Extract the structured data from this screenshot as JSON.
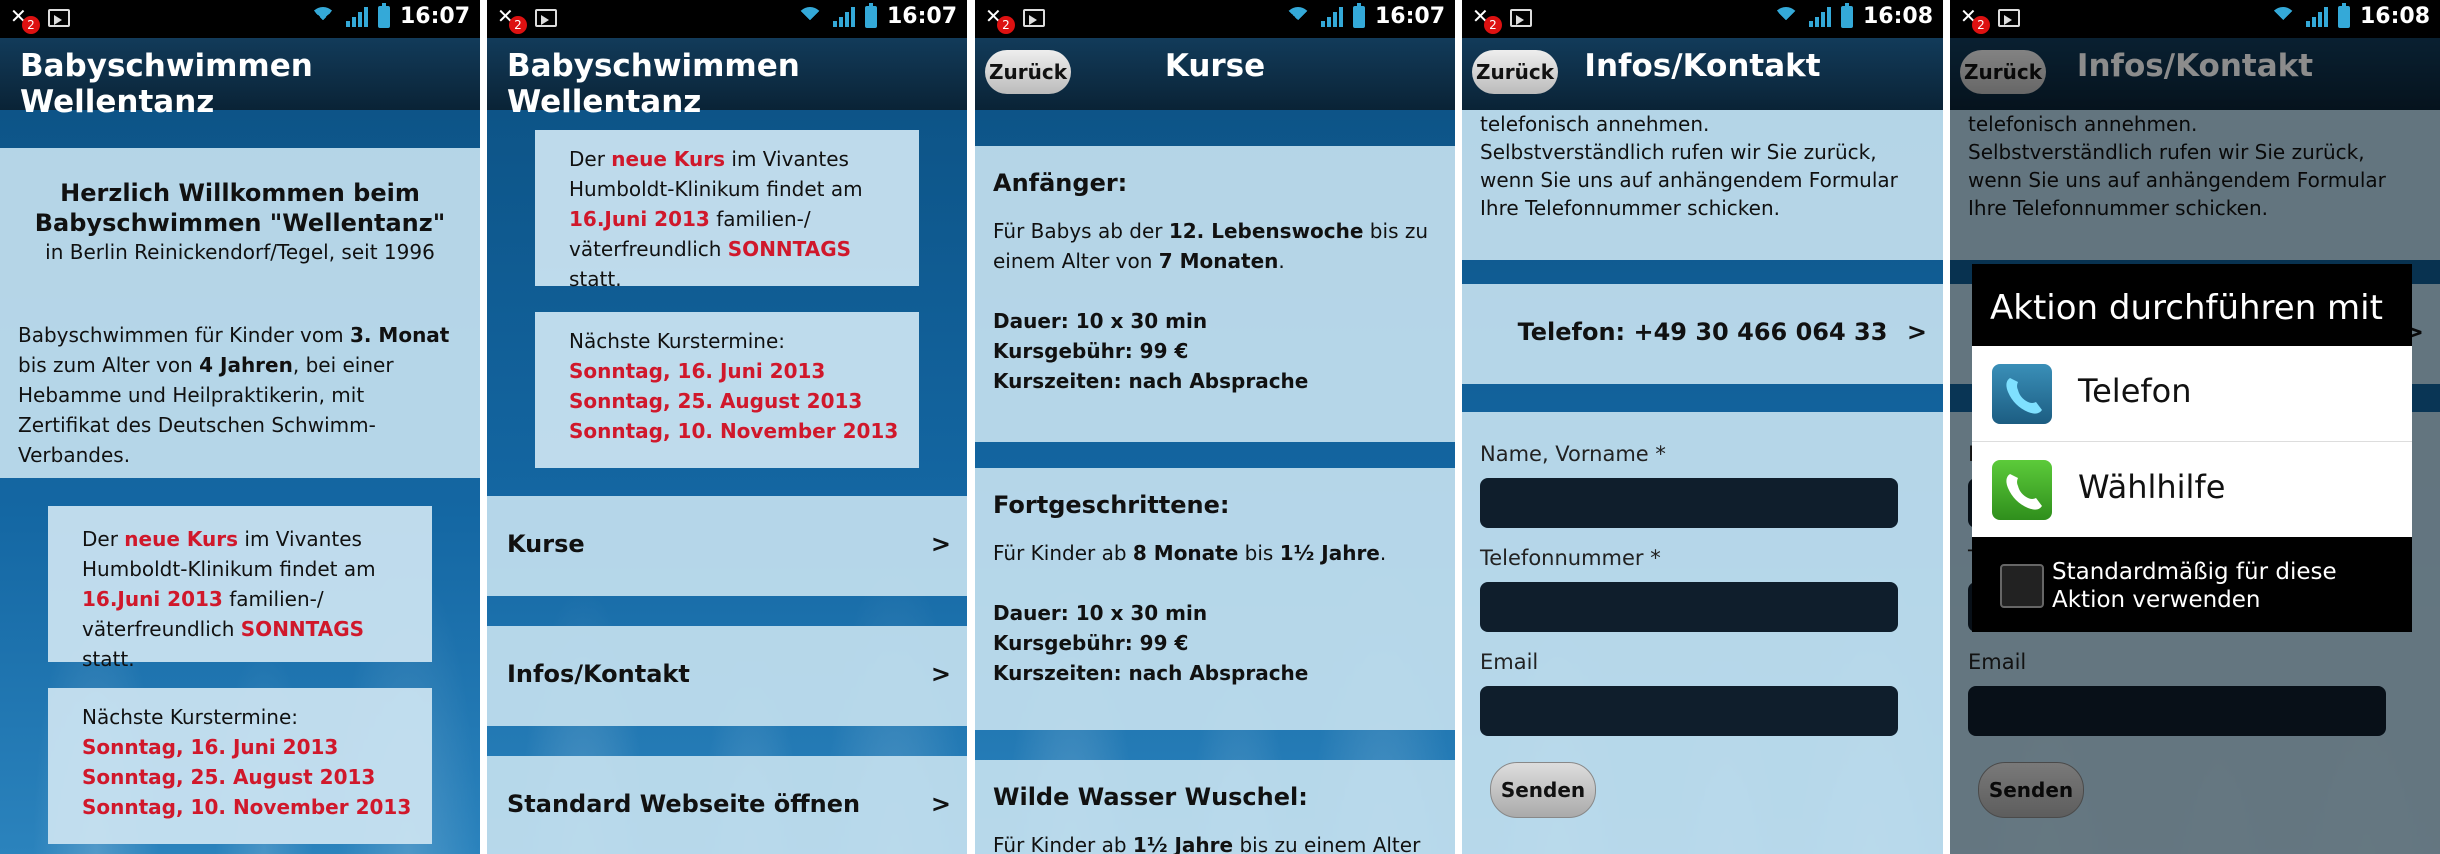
{
  "status": {
    "notif_count": "2",
    "times": [
      "16:07",
      "16:07",
      "16:07",
      "16:08",
      "16:08"
    ]
  },
  "screen1": {
    "title": "Babyschwimmen Wellentanz",
    "welcome_line1": "Herzlich Willkommen beim",
    "welcome_line2": "Babyschwimmen \"Wellentanz\"",
    "welcome_line3": "in Berlin Reinickendorf/Tegel, seit 1996",
    "intro": {
      "t1": "Babyschwimmen für Kinder vom ",
      "b1": "3. Monat",
      "t2": " bis zum Alter von ",
      "b2": "4 Jahren",
      "t3": ", bei einer Hebamme und Heilpraktikerin, mit Zertifikat des Deutschen Schwimm-Verbandes."
    }
  },
  "news": {
    "t1": "Der ",
    "r1": "neue Kurs",
    "t2": " im Vivantes Humboldt-Klinikum findet am ",
    "r2": "16.Juni 2013",
    "t3": " familien-/ väterfreundlich ",
    "r3": "SONNTAGS",
    "t4": " statt."
  },
  "dates": {
    "heading": "Nächste Kurstermine:",
    "items": [
      "Sonntag, 16. Juni 2013",
      "Sonntag, 25. August 2013",
      "Sonntag, 10. November 2013"
    ]
  },
  "screen2": {
    "title": "Babyschwimmen Wellentanz",
    "nav": [
      {
        "label": "Kurse",
        "arrow": ">"
      },
      {
        "label": "Infos/Kontakt",
        "arrow": ">"
      },
      {
        "label": "Standard Webseite öffnen",
        "arrow": ">"
      }
    ]
  },
  "screen3": {
    "back": "Zurück",
    "title": "Kurse",
    "courses": [
      {
        "name": "Anfänger:",
        "d1": "Für Babys ab der ",
        "b1": "12. Lebenswoche",
        "d2": " bis zu einem Alter von ",
        "b2": "7 Monaten",
        "d3": ".",
        "dauer": "Dauer: 10 x 30 min",
        "gebuehr": "Kursgebühr: 99 €",
        "zeiten": "Kurszeiten: nach Absprache"
      },
      {
        "name": "Fortgeschrittene:",
        "d1": "Für Kinder ab ",
        "b1": "8 Monate",
        "d2": " bis ",
        "b2": "1½ Jahre",
        "d3": ".",
        "dauer": "Dauer: 10 x 30 min",
        "gebuehr": "Kursgebühr: 99 €",
        "zeiten": "Kurszeiten: nach Absprache"
      },
      {
        "name": "Wilde Wasser Wuschel:",
        "d1": "Für Kinder ab ",
        "b1": "1½ Jahre",
        "d2": " bis zu einem Alter von",
        "b2": "",
        "d3": ""
      }
    ]
  },
  "screen4": {
    "back": "Zurück",
    "title": "Infos/Kontakt",
    "text1": "telefonisch annehmen.",
    "text2": "Selbstverständlich rufen wir Sie zurück, wenn Sie uns auf anhängendem Formular Ihre Telefonnummer schicken.",
    "phone": "Telefon: +49 30 466 064 33",
    "arrow": ">",
    "name_label": "Name, Vorname *",
    "tel_label": "Telefonnummer *",
    "email_label": "Email",
    "send": "Senden"
  },
  "dialog": {
    "title": "Aktion durchführen mit",
    "options": [
      "Telefon",
      "Wählhilfe"
    ],
    "checkbox": "Standardmäßig für diese Aktion verwenden"
  },
  "colors": {
    "accent_red": "#d0182b",
    "status_blue": "#34a9d8"
  }
}
